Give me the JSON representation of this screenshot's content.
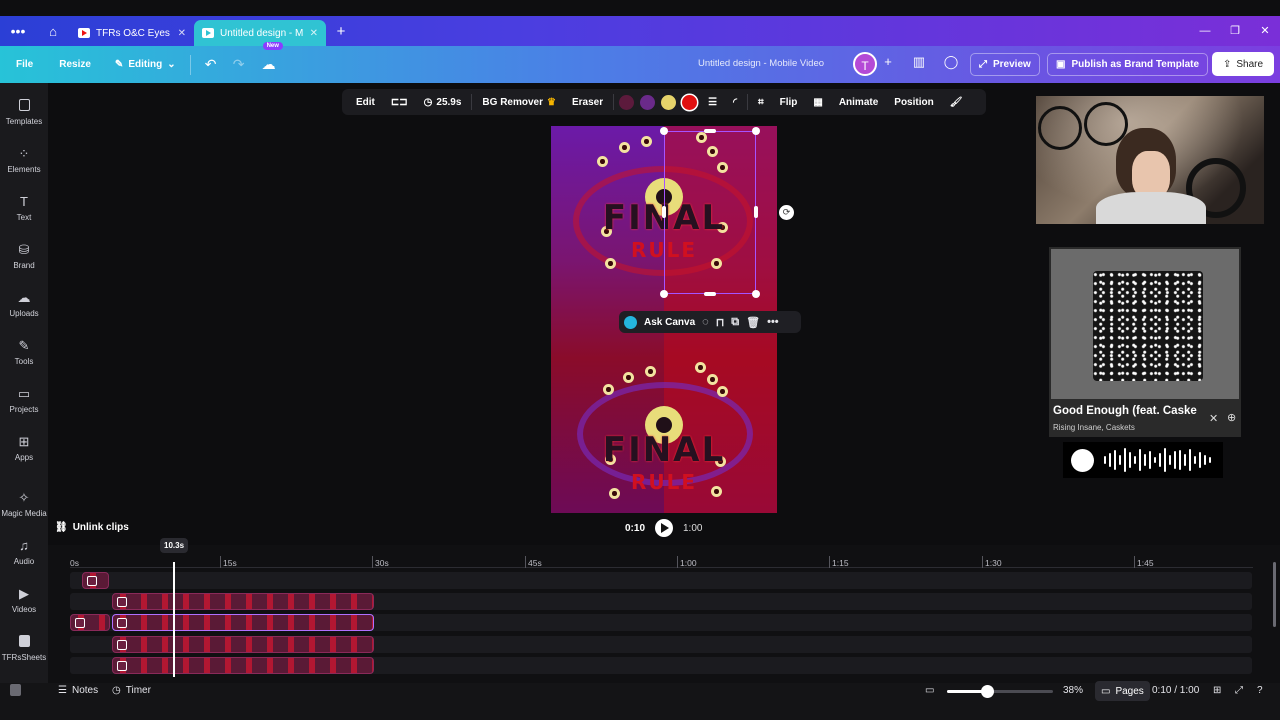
{
  "browser": {
    "tabs": [
      {
        "title": "TFRs O&C Eyes - Yo…",
        "active": false
      },
      {
        "title": "Untitled design - M…",
        "active": true
      }
    ]
  },
  "header": {
    "file": "File",
    "resize": "Resize",
    "editing": "Editing",
    "new_badge": "New",
    "doc_title": "Untitled design - Mobile Video",
    "avatar_letter": "T",
    "preview": "Preview",
    "publish": "Publish as Brand Template",
    "share": "Share"
  },
  "sidebar": {
    "items": [
      {
        "label": "Templates",
        "icon": "templates-icon"
      },
      {
        "label": "Elements",
        "icon": "elements-icon"
      },
      {
        "label": "Text",
        "icon": "text-icon"
      },
      {
        "label": "Brand",
        "icon": "brand-icon"
      },
      {
        "label": "Uploads",
        "icon": "uploads-icon"
      },
      {
        "label": "Tools",
        "icon": "tools-icon"
      },
      {
        "label": "Projects",
        "icon": "projects-icon"
      },
      {
        "label": "Apps",
        "icon": "apps-icon"
      },
      {
        "label": "Magic Media",
        "icon": "magic-media-icon"
      },
      {
        "label": "Audio",
        "icon": "audio-icon"
      },
      {
        "label": "Videos",
        "icon": "videos-icon"
      },
      {
        "label": "TFRsSheets",
        "icon": "sheets-icon"
      }
    ]
  },
  "toolbar": {
    "edit": "Edit",
    "duration": "25.9s",
    "bg_remover": "BG Remover",
    "eraser": "Eraser",
    "flip": "Flip",
    "animate": "Animate",
    "position": "Position",
    "swatches": [
      "#5c1a3c",
      "#6a2a8a",
      "#e6d36a",
      "#e01010"
    ]
  },
  "canvas": {
    "logo_line1": "FINAL",
    "logo_line2": "RULE"
  },
  "ask": {
    "label": "Ask Canva"
  },
  "spotify": {
    "song": "Good Enough (feat. Caske",
    "artist": "Rising Insane, Caskets"
  },
  "playback": {
    "current": "0:10",
    "total": "1:00",
    "unlink": "Unlink clips"
  },
  "timeline": {
    "playhead": "10.3s",
    "ruler": [
      "0s",
      "15s",
      "30s",
      "45s",
      "1:00",
      "1:15",
      "1:30",
      "1:45"
    ]
  },
  "footer": {
    "notes": "Notes",
    "timer": "Timer",
    "zoom": "38%",
    "zoom_fraction": 0.38,
    "pages": "Pages",
    "time": "0:10 / 1:00"
  }
}
